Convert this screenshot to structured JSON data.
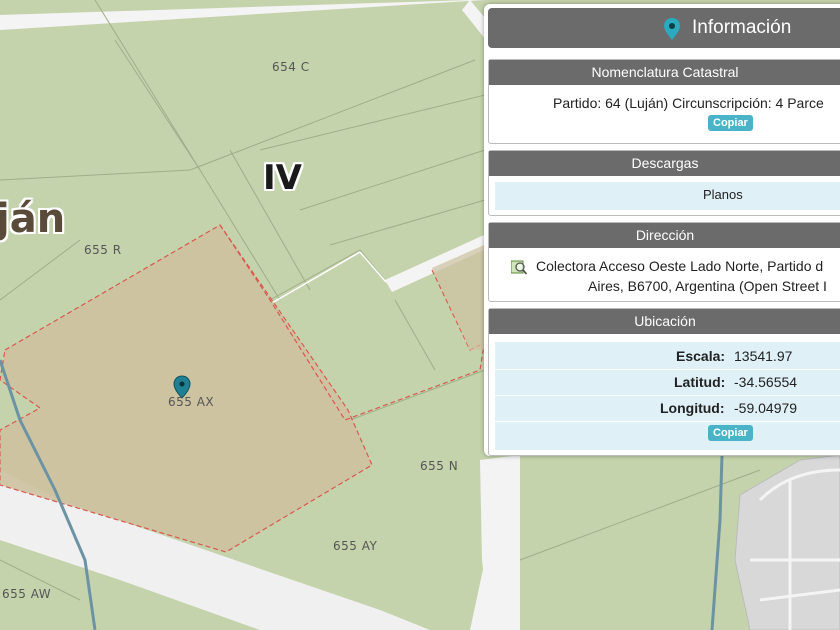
{
  "map": {
    "labels": {
      "l654c": "654 C",
      "l655r": "655 R",
      "l655ax": "655 AX",
      "l655n": "655 N",
      "l655ay": "655 AY",
      "l655aw": "655 AW",
      "circ": "IV",
      "town": "ján"
    }
  },
  "panel": {
    "title": "Información",
    "nomenclatura": {
      "header": "Nomenclatura Catastral",
      "text": "Partido: 64 (Luján) Circunscripción: 4 Parce",
      "copy_label": "Copiar"
    },
    "descargas": {
      "header": "Descargas",
      "item": "Planos"
    },
    "direccion": {
      "header": "Dirección",
      "line1": "Colectora Acceso Oeste Lado Norte, Partido d",
      "line2": "Aires, B6700, Argentina (Open Street I"
    },
    "ubicacion": {
      "header": "Ubicación",
      "escala_label": "Escala:",
      "escala_value": "13541.97",
      "latitud_label": "Latitud:",
      "latitud_value": "-34.56554",
      "longitud_label": "Longitud:",
      "longitud_value": "-59.04979",
      "copy_label": "Copiar"
    }
  },
  "colors": {
    "parcel_fill": "#c6d3ae",
    "selected_fill": "#cdc1a0",
    "selection_border": "#d9584f",
    "road": "#f2f2f2",
    "river": "#6b93a3",
    "panel_header": "#6b6b6b",
    "copy_button": "#4ab3c8",
    "pin": "#1f7f93"
  }
}
